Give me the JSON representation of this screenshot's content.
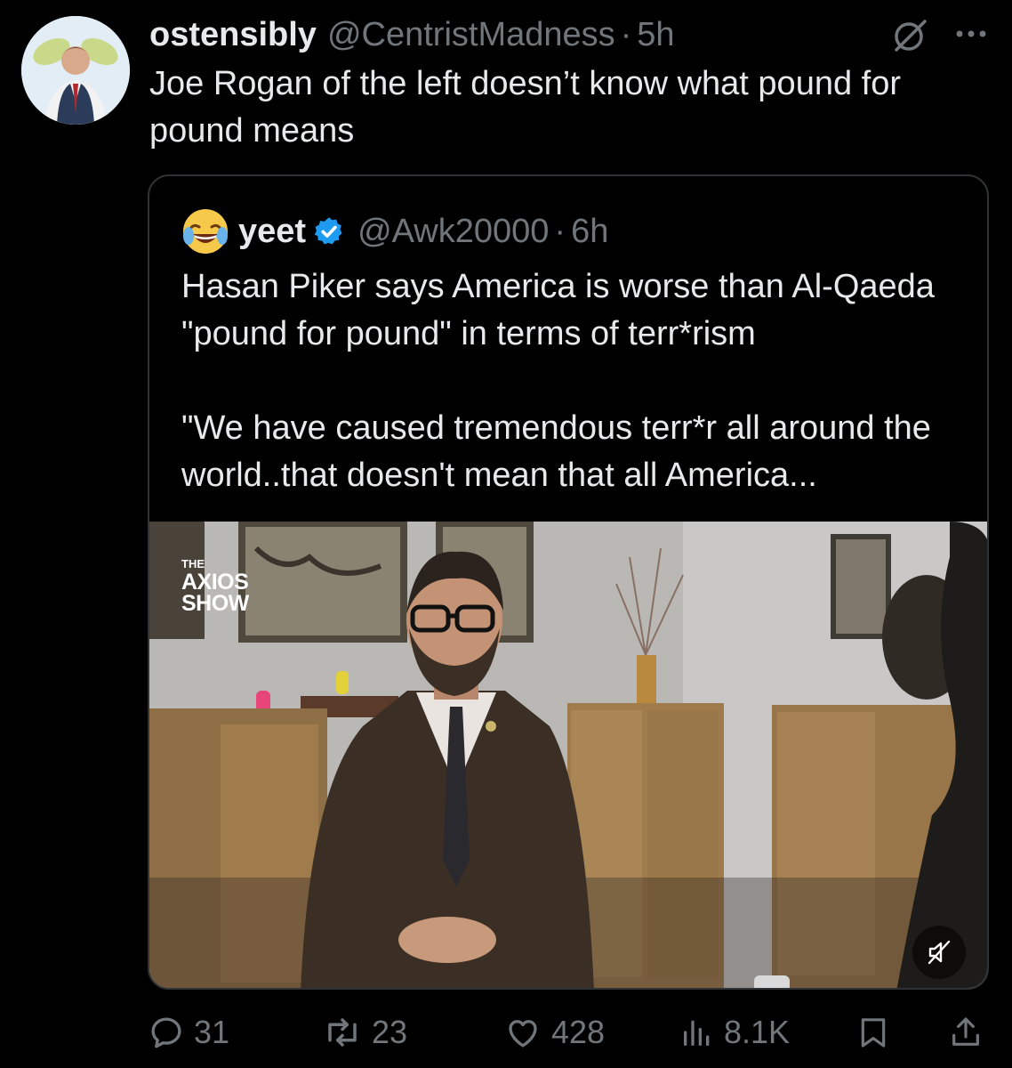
{
  "post": {
    "author_name": "ostensibly",
    "author_handle": "@CentristMadness",
    "separator": "·",
    "time": "5h",
    "text": "Joe Rogan of the left doesn’t know what pound for pound means"
  },
  "quoted_post": {
    "author_name": "yeet",
    "author_handle": "@Awk20000",
    "separator": "·",
    "time": "6h",
    "paragraph_1": "Hasan Piker says America is worse than Al-Qaeda \"pound for pound\" in terms of terr*rism",
    "paragraph_2": "\"We have caused tremendous terr*r all around the world..that doesn't mean that all America...",
    "media": {
      "logo_top": "THE",
      "logo_line_1": "AXIOS",
      "logo_line_2": "SHOW"
    }
  },
  "actions": {
    "replies": "31",
    "reposts": "23",
    "likes": "428",
    "views": "8.1K"
  },
  "colors": {
    "background": "#000000",
    "text": "#e7e9ea",
    "secondary": "#71767b",
    "verified": "#1d9bf0",
    "border": "#2f3336"
  },
  "icons": [
    "grok-icon",
    "more-icon",
    "verified-icon",
    "mute-icon",
    "reply-icon",
    "repost-icon",
    "like-icon",
    "views-icon",
    "bookmark-icon",
    "share-icon"
  ]
}
